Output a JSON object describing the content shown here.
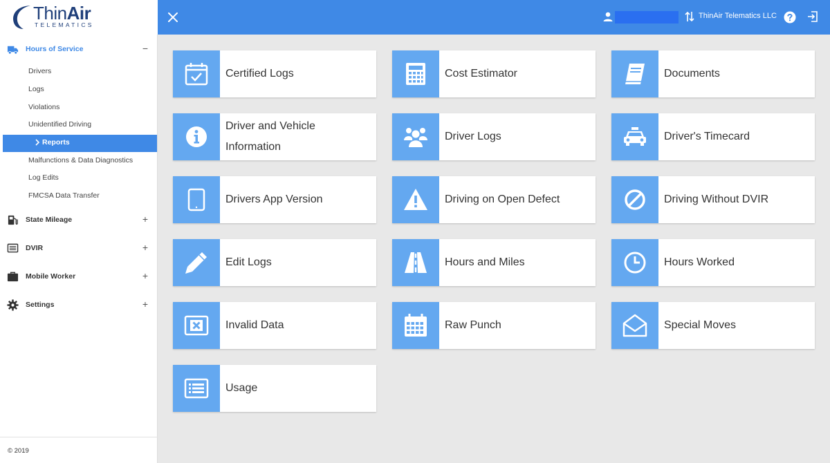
{
  "header": {
    "logo_word_thin": "Thin",
    "logo_word_bold": "Air",
    "logo_sub": "TELEMATICS",
    "company": "ThinAir Telematics LLC"
  },
  "sidebar": {
    "groups": [
      {
        "label": "Hours of Service",
        "toggle": "−",
        "icon": "truck-icon"
      },
      {
        "label": "State Mileage",
        "toggle": "+",
        "icon": "fuel-pump-icon"
      },
      {
        "label": "DVIR",
        "toggle": "+",
        "icon": "list-icon"
      },
      {
        "label": "Mobile Worker",
        "toggle": "+",
        "icon": "briefcase-icon"
      },
      {
        "label": "Settings",
        "toggle": "+",
        "icon": "gear-icon"
      }
    ],
    "items": [
      {
        "label": "Drivers"
      },
      {
        "label": "Logs"
      },
      {
        "label": "Violations"
      },
      {
        "label": "Unidentified Driving"
      },
      {
        "label": "Reports"
      },
      {
        "label": "Malfunctions & Data Diagnostics"
      },
      {
        "label": "Log Edits"
      },
      {
        "label": "FMCSA Data Transfer"
      }
    ],
    "footer": "© 2019"
  },
  "reports": [
    {
      "label": "Certified Logs",
      "icon": "calendar-check-icon"
    },
    {
      "label": "Cost Estimator",
      "icon": "calculator-icon"
    },
    {
      "label": "Documents",
      "icon": "book-icon"
    },
    {
      "label": "Driver and Vehicle Information",
      "icon": "info-icon"
    },
    {
      "label": "Driver Logs",
      "icon": "users-icon"
    },
    {
      "label": "Driver's Timecard",
      "icon": "taxi-icon"
    },
    {
      "label": "Drivers App Version",
      "icon": "tablet-icon"
    },
    {
      "label": "Driving on Open Defect",
      "icon": "warning-icon"
    },
    {
      "label": "Driving Without DVIR",
      "icon": "ban-icon"
    },
    {
      "label": "Edit Logs",
      "icon": "pencil-icon"
    },
    {
      "label": "Hours and Miles",
      "icon": "road-icon"
    },
    {
      "label": "Hours Worked",
      "icon": "clock-icon"
    },
    {
      "label": "Invalid Data",
      "icon": "x-box-icon"
    },
    {
      "label": "Raw Punch",
      "icon": "calendar-grid-icon"
    },
    {
      "label": "Special Moves",
      "icon": "open-envelope-icon"
    },
    {
      "label": "Usage",
      "icon": "list-box-icon"
    }
  ],
  "colors": {
    "accent": "#3f89e6",
    "tile": "#64a8f0",
    "background": "#e8e8e8"
  }
}
